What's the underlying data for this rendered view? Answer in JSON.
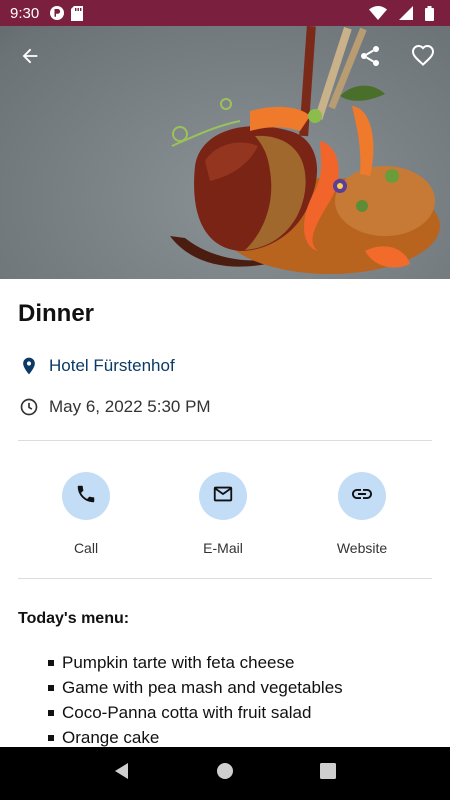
{
  "status_bar": {
    "time": "9:30",
    "icons": [
      "app-notification-icon",
      "sd-card-icon",
      "wifi-icon",
      "cellular-signal-icon",
      "battery-icon"
    ],
    "background": "#7a1f3d"
  },
  "hero": {
    "image": "plated-dinner-food-photo",
    "icons": [
      "back-arrow-icon",
      "share-icon",
      "heart-outline-icon"
    ]
  },
  "event": {
    "title": "Dinner",
    "location": "Hotel Fürstenhof",
    "datetime": "May 6, 2022 5:30 PM",
    "location_icon": "location-pin-icon",
    "time_icon": "clock-icon"
  },
  "actions": [
    {
      "label": "Call",
      "icon": "phone-icon"
    },
    {
      "label": "E-Mail",
      "icon": "mail-icon"
    },
    {
      "label": "Website",
      "icon": "link-icon"
    }
  ],
  "menu": {
    "heading": "Today's menu:",
    "items": [
      "Pumpkin tarte with feta cheese",
      "Game with pea mash and vegetables",
      "Coco-Panna cotta with fruit salad",
      "Orange cake"
    ]
  },
  "nav_bar": {
    "icons": [
      "nav-back-icon",
      "nav-home-icon",
      "nav-recents-icon"
    ]
  },
  "colors": {
    "accent_circle": "#c4ddf6",
    "location_text": "#0b3a66"
  }
}
